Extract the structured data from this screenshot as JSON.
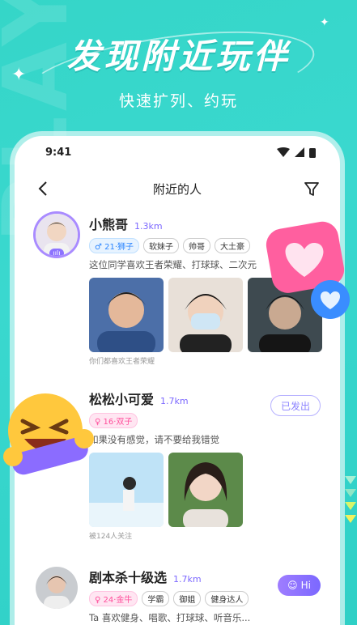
{
  "promo": {
    "headline": "发现附近玩伴",
    "subline": "快速扩列、约玩"
  },
  "status_bar": {
    "time": "9:41"
  },
  "nav": {
    "title": "附近的人"
  },
  "users": [
    {
      "name": "小熊哥",
      "distance": "1.3km",
      "tags": [
        "♂ 21·狮子",
        "软妹子",
        "帅哥",
        "大土豪"
      ],
      "bio": "这位同学喜欢王者荣耀、打球球、二次元",
      "footnote": "你们都喜欢王者荣耀",
      "action": ""
    },
    {
      "name": "松松小可爱",
      "distance": "1.7km",
      "tags": [
        "♀ 16·双子"
      ],
      "bio": "如果没有感觉，请不要给我错觉",
      "footnote": "被124人关注",
      "action": "已发出"
    },
    {
      "name": "剧本杀十级选",
      "distance": "1.7km",
      "tags": [
        "♀ 24·金牛",
        "学霸",
        "御姐",
        "健身达人"
      ],
      "bio": "Ta 喜欢健身、唱歌、打球球、听音乐...",
      "footnote": "",
      "action": "Hi"
    }
  ],
  "colors": {
    "accent": "#7b68ff",
    "teal": "#35d6c8",
    "pink": "#ff4f9b"
  }
}
